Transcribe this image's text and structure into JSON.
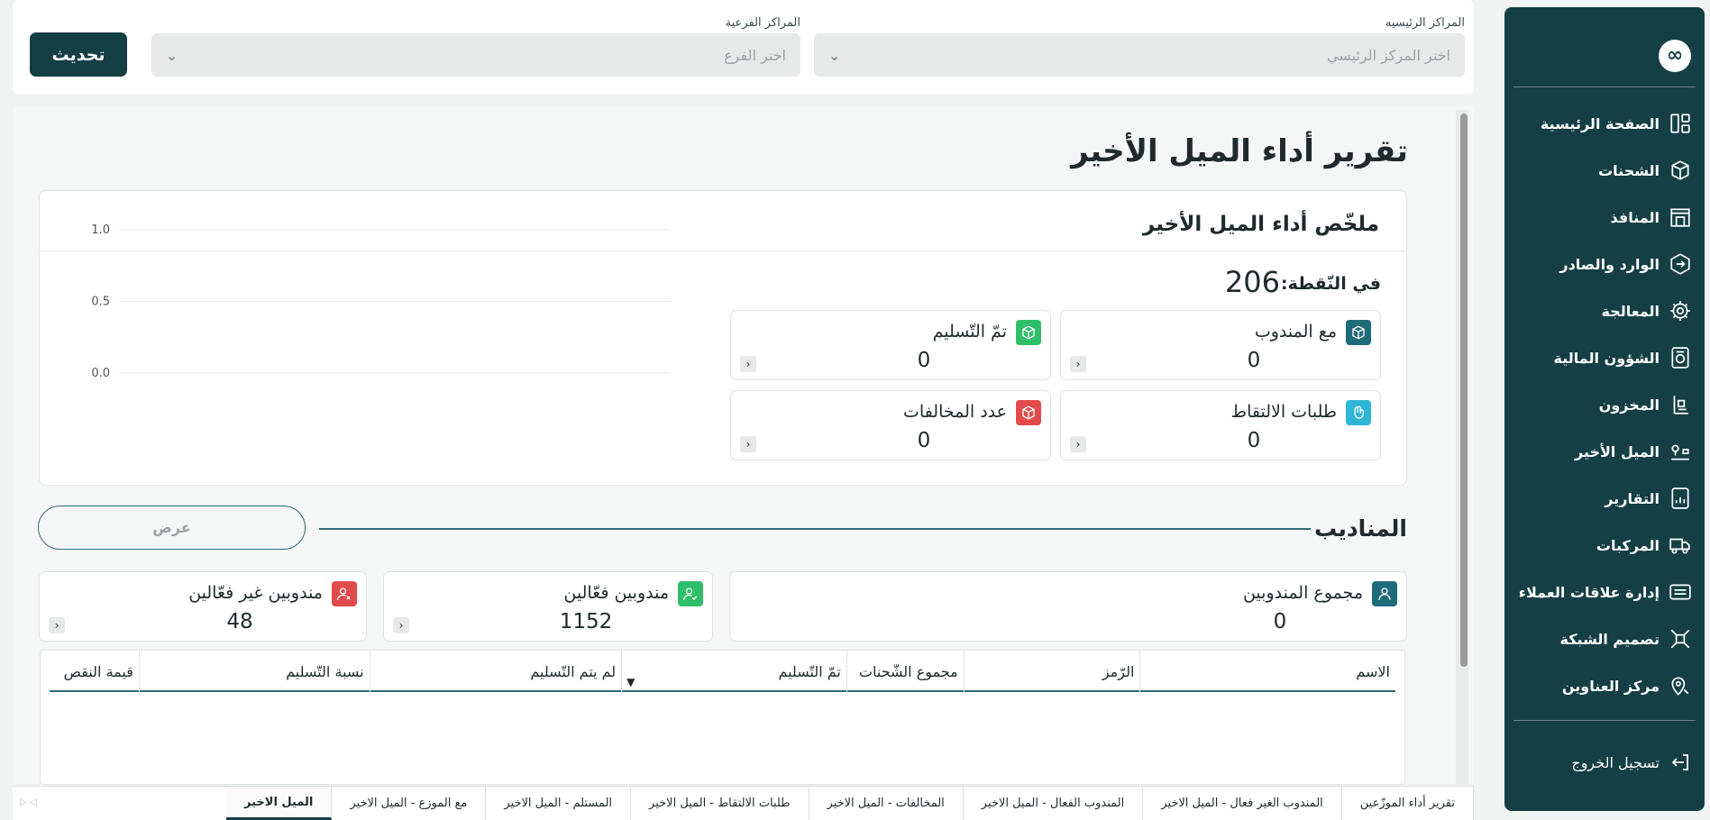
{
  "filters": {
    "main_center_label": "المراكز الرئيسيه",
    "main_center_placeholder": "اختر المركز الرئيسي",
    "sub_center_label": "المراكز الفرعية",
    "sub_center_placeholder": "اختر الفرع",
    "refresh_label": "تحديث"
  },
  "sidebar": {
    "logo": "∞",
    "items": [
      {
        "label": "الصفحة الرئيسية",
        "icon": "dashboard-icon"
      },
      {
        "label": "الشحنات",
        "icon": "box-icon"
      },
      {
        "label": "المنافذ",
        "icon": "store-icon"
      },
      {
        "label": "الوارد والصادر",
        "icon": "inout-icon"
      },
      {
        "label": "المعالجة",
        "icon": "gear-icon"
      },
      {
        "label": "الشؤون المالية",
        "icon": "finance-icon"
      },
      {
        "label": "المخزون",
        "icon": "inventory-icon"
      },
      {
        "label": "الميل الأخير",
        "icon": "route-icon"
      },
      {
        "label": "التقارير",
        "icon": "report-icon"
      },
      {
        "label": "المركبات",
        "icon": "truck-icon"
      },
      {
        "label": "إدارة علاقات العملاء",
        "icon": "crm-icon"
      },
      {
        "label": "تصميم الشبكة",
        "icon": "network-icon"
      },
      {
        "label": "مركز العناوين",
        "icon": "location-icon"
      }
    ],
    "logout_label": "تسجيل الخروج"
  },
  "page": {
    "title": "تقرير أداء الميل الأخير"
  },
  "summary": {
    "title": "ملخّص أداء الميل الأخير",
    "point_label": "في النّقطة:",
    "point_value": "206",
    "cards": [
      {
        "label": "مع المندوب",
        "value": "0",
        "color": "#1f6b7a"
      },
      {
        "label": "تمّ التّسليم",
        "value": "0",
        "color": "#2fbf6a"
      },
      {
        "label": "طلبات الالتقاط",
        "value": "0",
        "color": "#2fb6d6"
      },
      {
        "label": "عدد المخالفات",
        "value": "0",
        "color": "#e24b4b"
      }
    ]
  },
  "chart_data": {
    "type": "line",
    "y_ticks": [
      "1.0",
      "0.5",
      "0.0"
    ],
    "ylim": [
      0,
      1
    ],
    "series": []
  },
  "reps": {
    "title": "المناديب",
    "show_label": "عرض",
    "cards": [
      {
        "label": "مجموع المندوبين",
        "value": "0",
        "color": "#1f6b7a"
      },
      {
        "label": "مندوبين فعّالين",
        "value": "1152",
        "color": "#2fbf6a"
      },
      {
        "label": "مندوبين غير فعّالين",
        "value": "48",
        "color": "#e24b4b"
      }
    ]
  },
  "table": {
    "columns": [
      "الاسم",
      "الرّمز",
      "مجموع الشّحنات",
      "تمّ التّسليم",
      "لم يتم التّسليم",
      "نسبة التّسليم",
      "قيمة النقص"
    ]
  },
  "tabs": [
    "تقرير أداء الموزّعين",
    "المندوب الغير فعال - الميل الاخير",
    "المندوب الفعال - الميل الاخير",
    "المخالفات - الميل الاخير",
    "طلبات الالتقاط - الميل الاخير",
    "المستلم - الميل الاخير",
    "مع الموزع - الميل الاخير",
    "الميل الاخير"
  ]
}
